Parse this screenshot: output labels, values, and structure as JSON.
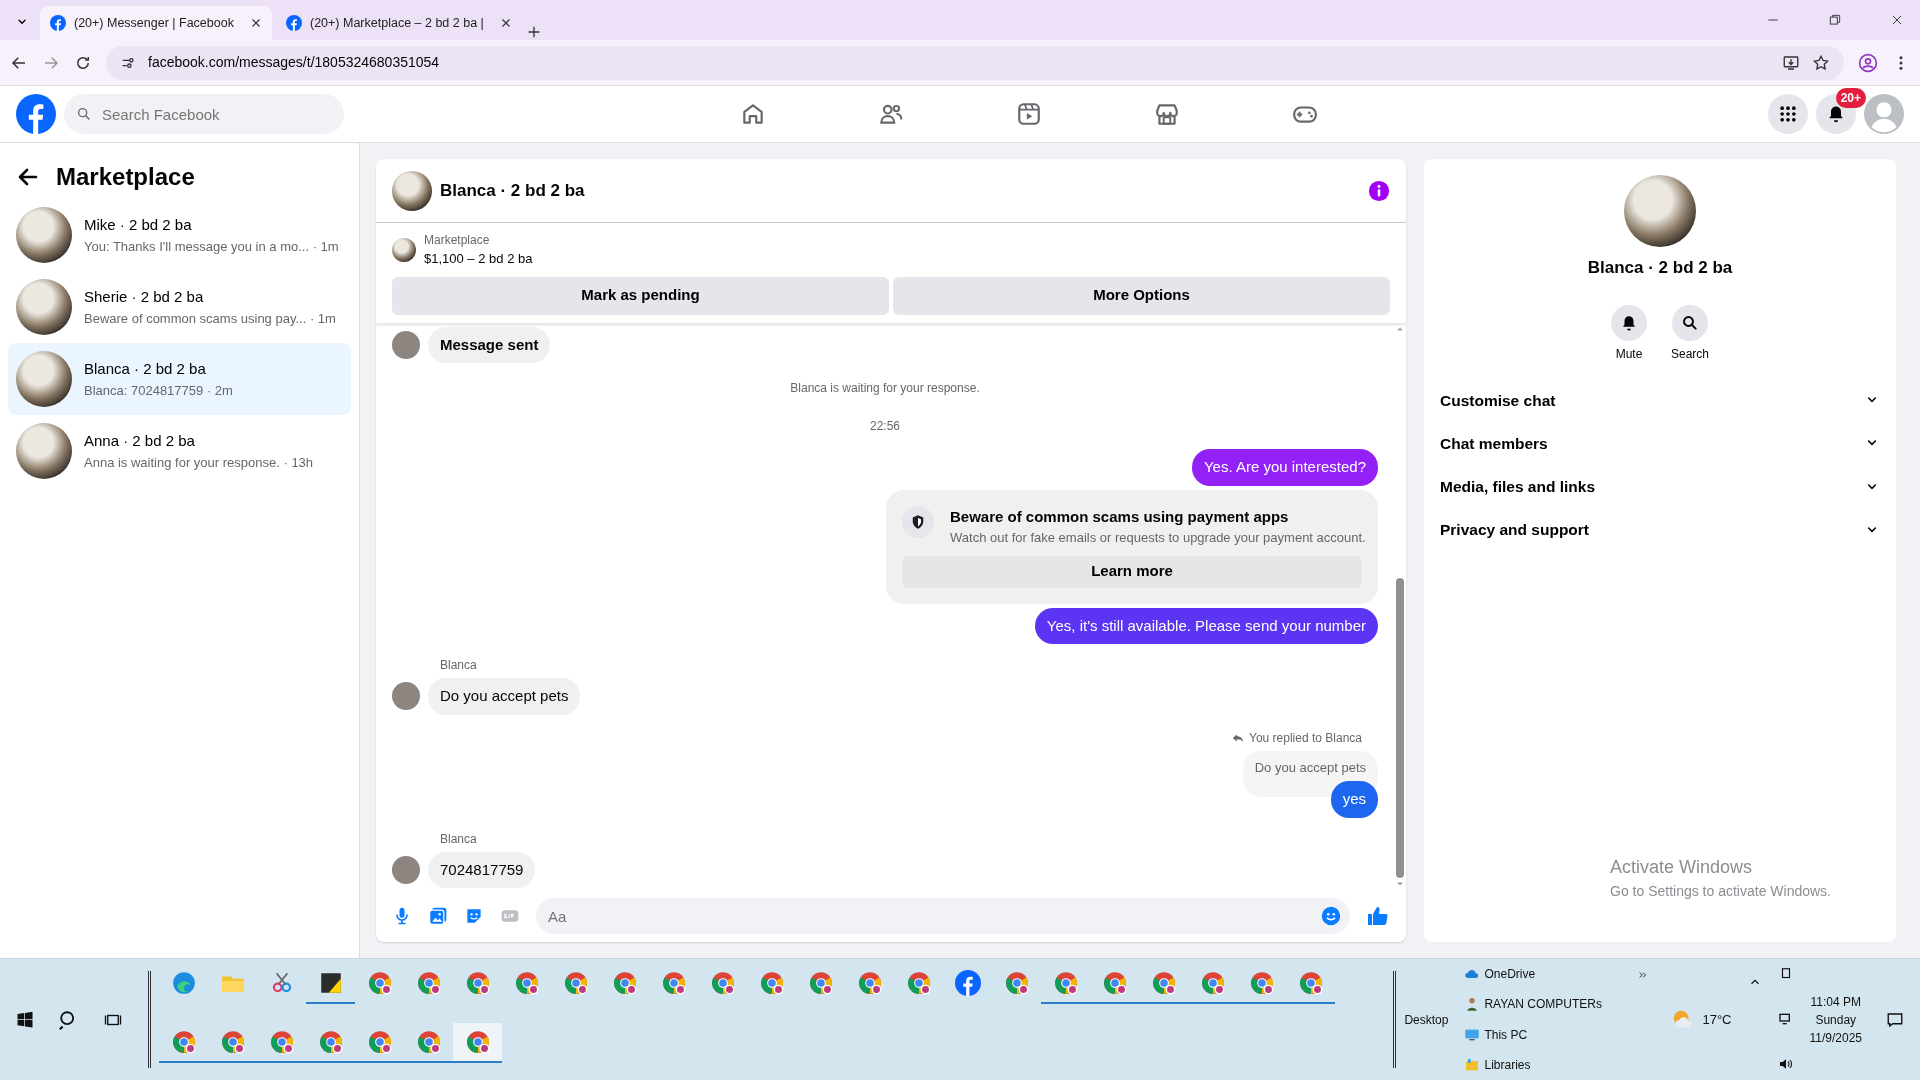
{
  "browser": {
    "tabs": [
      {
        "title": "(20+) Messenger | Facebook",
        "selected": true
      },
      {
        "title": "(20+) Marketplace – 2 bd 2 ba |",
        "selected": false
      }
    ],
    "url": "facebook.com/messages/t/1805324680351054"
  },
  "facebook_header": {
    "search_placeholder": "Search Facebook",
    "nav": [
      {
        "kind": "home",
        "selected": false
      },
      {
        "kind": "friends",
        "selected": false
      },
      {
        "kind": "video",
        "selected": false
      },
      {
        "kind": "marketplace",
        "selected": false
      },
      {
        "kind": "gaming",
        "selected": false
      }
    ],
    "notification_count": "20+"
  },
  "sidebar": {
    "title": "Marketplace",
    "conversations": [
      {
        "name": "Mike · 2 bd 2 ba",
        "preview": "You: Thanks I'll message you in a mo...",
        "time": "· 1m",
        "selected": false
      },
      {
        "name": "Sherie · 2 bd 2 ba",
        "preview": "Beware of common scams using pay...",
        "time": "· 1m",
        "selected": false
      },
      {
        "name": "Blanca · 2 bd 2 ba",
        "preview": "Blanca: 7024817759",
        "time": "· 2m",
        "selected": true
      },
      {
        "name": "Anna · 2 bd 2 ba",
        "preview": "Anna is waiting for your response.",
        "time": "· 13h",
        "selected": false
      }
    ]
  },
  "chat": {
    "title": "Blanca · 2 bd 2 ba",
    "listing": {
      "source": "Marketplace",
      "price": "$1,100 – 2 bd 2 ba"
    },
    "actions": [
      "Mark as pending",
      "More Options"
    ],
    "messages": [
      {
        "kind": "incoming",
        "text": "Message sent"
      },
      {
        "kind": "system",
        "text": "Blanca is waiting for your response."
      },
      {
        "kind": "timestamp",
        "text": "22:56"
      },
      {
        "kind": "outgoing",
        "text": "Yes. Are you interested?",
        "color": "#9320f4"
      },
      {
        "kind": "notice",
        "title": "Beware of common scams using payment apps",
        "body": "Watch out for fake emails or requests to upgrade your payment account.",
        "button": "Learn more"
      },
      {
        "kind": "outgoing",
        "text": "Yes, it's still available. Please send your number",
        "color": "#5b34f4"
      },
      {
        "kind": "incoming",
        "sender": "Blanca",
        "text": "Do you accept pets"
      },
      {
        "kind": "reply",
        "label": "You replied to Blanca",
        "quoted": "Do you accept pets",
        "text": "yes",
        "color": "#1d66ef"
      },
      {
        "kind": "incoming",
        "sender": "Blanca",
        "text": "7024817759"
      }
    ],
    "composer_placeholder": "Aa"
  },
  "info_panel": {
    "name": "Blanca · 2 bd 2 ba",
    "actions": [
      {
        "kind": "bell",
        "label": "Mute"
      },
      {
        "kind": "search",
        "label": "Search"
      }
    ],
    "sections": [
      "Customise chat",
      "Chat members",
      "Media, files and links",
      "Privacy and support"
    ]
  },
  "activation_notice": {
    "title": "Activate Windows",
    "body": "Go to Settings to activate Windows."
  },
  "taskbar": {
    "apps": [
      {
        "kind": "edge",
        "running": false,
        "selected": false
      },
      {
        "kind": "folder",
        "running": false,
        "selected": false
      },
      {
        "kind": "snip",
        "running": false,
        "selected": false
      },
      {
        "kind": "notes",
        "running": true,
        "selected": false
      },
      {
        "kind": "chrome",
        "running": false,
        "selected": false
      },
      {
        "kind": "chrome",
        "running": false,
        "selected": false
      },
      {
        "kind": "chrome",
        "running": false,
        "selected": false
      },
      {
        "kind": "chrome",
        "running": false,
        "selected": false
      },
      {
        "kind": "chrome",
        "running": false,
        "selected": false
      },
      {
        "kind": "chrome",
        "running": false,
        "selected": false
      },
      {
        "kind": "chrome",
        "running": false,
        "selected": false
      },
      {
        "kind": "chrome",
        "running": false,
        "selected": false
      },
      {
        "kind": "chrome",
        "running": false,
        "selected": false
      },
      {
        "kind": "chrome",
        "running": false,
        "selected": false
      },
      {
        "kind": "chrome",
        "running": false,
        "selected": false
      },
      {
        "kind": "chrome",
        "running": false,
        "selected": false
      },
      {
        "kind": "facebook",
        "running": false,
        "selected": false
      },
      {
        "kind": "chrome",
        "running": false,
        "selected": false
      },
      {
        "kind": "chrome",
        "running": true,
        "selected": false
      },
      {
        "kind": "chrome",
        "running": true,
        "selected": false
      },
      {
        "kind": "chrome",
        "running": true,
        "selected": false
      },
      {
        "kind": "chrome",
        "running": true,
        "selected": false
      },
      {
        "kind": "chrome",
        "running": true,
        "selected": false
      },
      {
        "kind": "chrome",
        "running": true,
        "selected": false
      },
      {
        "kind": "chrome",
        "running": true,
        "selected": false
      },
      {
        "kind": "chrome",
        "running": true,
        "selected": false
      },
      {
        "kind": "chrome",
        "running": true,
        "selected": false
      },
      {
        "kind": "chrome",
        "running": true,
        "selected": false
      },
      {
        "kind": "chrome",
        "running": true,
        "selected": false
      },
      {
        "kind": "chrome",
        "running": true,
        "selected": false
      },
      {
        "kind": "chrome",
        "running": true,
        "selected": true
      }
    ],
    "desktop_label": "Desktop",
    "folders": [
      {
        "kind": "cloud",
        "label": "OneDrive"
      },
      {
        "kind": "user",
        "label": "RAYAN COMPUTERs"
      },
      {
        "kind": "pc",
        "label": "This PC"
      },
      {
        "kind": "library",
        "label": "Libraries"
      }
    ],
    "weather": "17°C",
    "time": "11:04 PM",
    "day": "Sunday",
    "date": "11/9/2025"
  }
}
